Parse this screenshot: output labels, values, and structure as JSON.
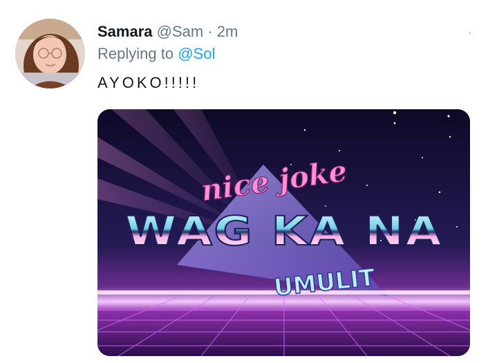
{
  "tweet": {
    "display_name": "Samara",
    "handle": "@Sam",
    "separator": "·",
    "time": "2m",
    "reply_prefix": "Replying to",
    "reply_to": "@Sol",
    "text": "AYOKO!!!!!",
    "more_icon": "more-icon"
  },
  "image": {
    "line1": "nice joke",
    "line2": "WAG KA NA",
    "line3": "UMULIT"
  },
  "colors": {
    "name": "#14171a",
    "secondary": "#657786",
    "link": "#1da1f2"
  }
}
